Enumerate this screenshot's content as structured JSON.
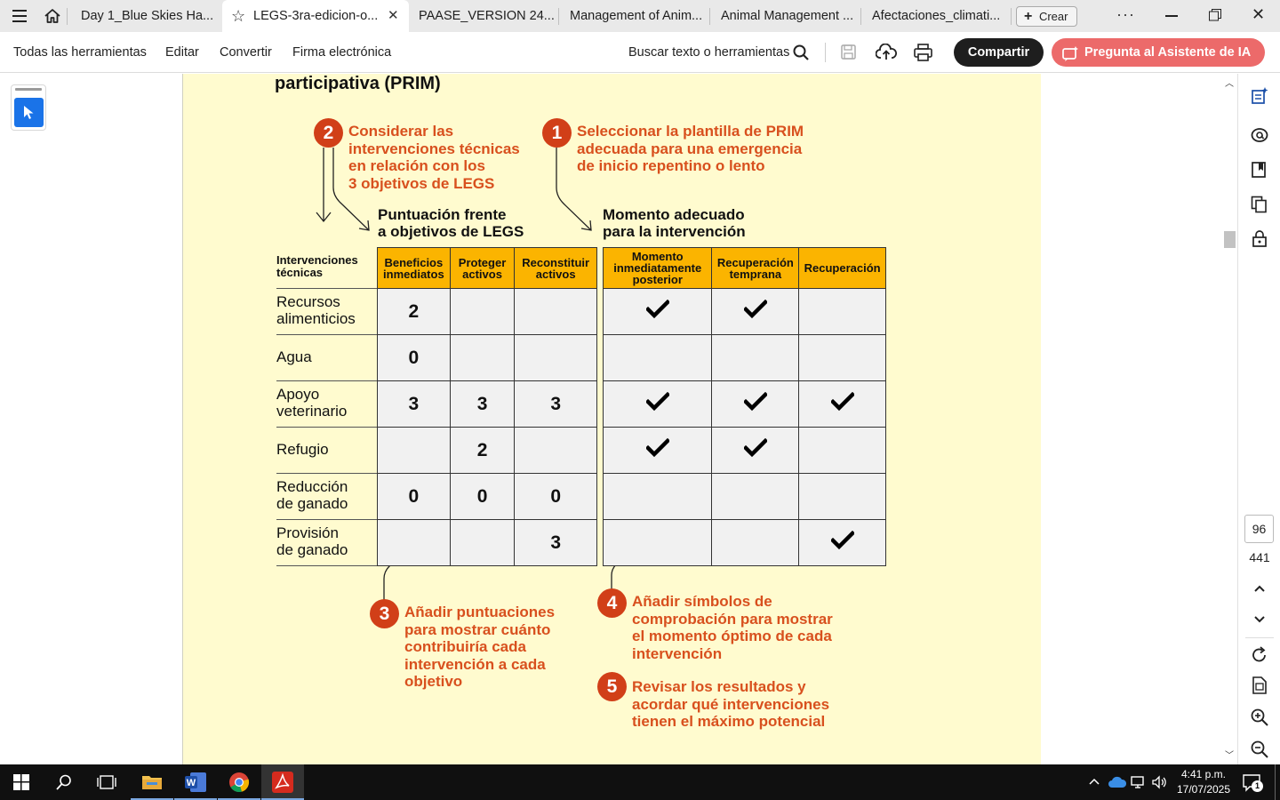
{
  "tabs": [
    {
      "label": "Day 1_Blue Skies Ha...",
      "active": false
    },
    {
      "label": "LEGS-3ra-edicion-o...",
      "active": true
    },
    {
      "label": "PAASE_VERSION 24...",
      "active": false
    },
    {
      "label": "Management of Anim...",
      "active": false
    },
    {
      "label": "Animal Management ...",
      "active": false
    },
    {
      "label": "Afectaciones_climati...",
      "active": false
    }
  ],
  "create_label": "Crear",
  "menu": [
    "Todas las herramientas",
    "Editar",
    "Convertir",
    "Firma electrónica"
  ],
  "search_label": "Buscar texto o herramientas",
  "share_label": "Compartir",
  "ai_label": "Pregunta al Asistente de IA",
  "doc": {
    "heading": "participativa (PRIM)",
    "step2": {
      "num": "2",
      "lines": [
        "Considerar las",
        "intervenciones técnicas",
        "en relación con los",
        "3 objetivos de LEGS"
      ]
    },
    "step1": {
      "num": "1",
      "lines": [
        "Seleccionar la plantilla de PRIM",
        "adecuada para una emergencia",
        "de inicio repentino o lento"
      ]
    },
    "head_legs": [
      "Puntuación frente",
      "a objetivos de LEGS"
    ],
    "head_timing": [
      "Momento adecuado",
      "para la intervención"
    ],
    "col_interv": [
      "Intervenciones",
      "técnicas"
    ],
    "legs_cols": [
      [
        "Beneficios",
        "inmediatos"
      ],
      [
        "Proteger",
        "activos"
      ],
      [
        "Reconstituir",
        "activos"
      ]
    ],
    "timing_cols": [
      [
        "Momento",
        "inmediatamente",
        "posterior"
      ],
      [
        "Recuperación",
        "temprana"
      ],
      [
        "Recuperación"
      ]
    ],
    "rows": [
      {
        "label": [
          "Recursos",
          "alimenticios"
        ],
        "scores": [
          "2",
          "",
          ""
        ],
        "checks": [
          true,
          true,
          false
        ]
      },
      {
        "label": [
          "Agua"
        ],
        "scores": [
          "0",
          "",
          ""
        ],
        "checks": [
          false,
          false,
          false
        ]
      },
      {
        "label": [
          "Apoyo",
          "veterinario"
        ],
        "scores": [
          "3",
          "3",
          "3"
        ],
        "checks": [
          true,
          true,
          true
        ]
      },
      {
        "label": [
          "Refugio"
        ],
        "scores": [
          "",
          "2",
          ""
        ],
        "checks": [
          true,
          true,
          false
        ]
      },
      {
        "label": [
          "Reducción",
          "de ganado"
        ],
        "scores": [
          "0",
          "0",
          "0"
        ],
        "checks": [
          false,
          false,
          false
        ]
      },
      {
        "label": [
          "Provisión",
          "de ganado"
        ],
        "scores": [
          "",
          "",
          "3"
        ],
        "checks": [
          false,
          false,
          true
        ]
      }
    ],
    "step3": {
      "num": "3",
      "lines": [
        "Añadir puntuaciones",
        "para mostrar cuánto",
        "contribuiría cada",
        "intervención a cada",
        "objetivo"
      ]
    },
    "step4": {
      "num": "4",
      "lines": [
        "Añadir símbolos de",
        "comprobación para mostrar",
        "el momento óptimo de cada",
        "intervención"
      ]
    },
    "step5": {
      "num": "5",
      "lines": [
        "Revisar los resultados y",
        "acordar qué intervenciones",
        "tienen el máximo potencial"
      ]
    }
  },
  "page_current": "96",
  "page_total": "441",
  "clock": {
    "time": "4:41 p.m.",
    "date": "17/07/2025"
  },
  "notification_count": "1",
  "colors": {
    "header_orange": "#fbb400",
    "annotation_orange": "#d8501e",
    "step_red": "#d13f18",
    "page_bg": "#fffbcf",
    "share_bg": "#1e1e1e",
    "ai_bg": "#ec6a6a"
  }
}
